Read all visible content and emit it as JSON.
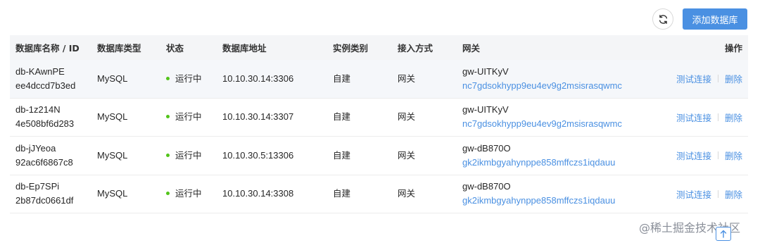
{
  "toolbar": {
    "refresh_icon": "refresh-icon",
    "add_label": "添加数据库"
  },
  "columns": {
    "name": "数据库名称 / ID",
    "type": "数据库类型",
    "status": "状态",
    "address": "数据库地址",
    "instance": "实例类别",
    "access": "接入方式",
    "gateway": "网关",
    "ops": "操作"
  },
  "rows": [
    {
      "name": "db-KAwnPE",
      "id": "ee4dccd7b3ed",
      "type": "MySQL",
      "status": "运行中",
      "address": "10.10.30.14:3306",
      "instance": "自建",
      "access": "网关",
      "gateway_name": "gw-UITKyV",
      "gateway_id": "nc7gdsokhypp9eu4ev9g2msisrasqwmc",
      "op_test": "测试连接",
      "op_delete": "删除"
    },
    {
      "name": "db-1z214N",
      "id": "4e508bf6d283",
      "type": "MySQL",
      "status": "运行中",
      "address": "10.10.30.14:3307",
      "instance": "自建",
      "access": "网关",
      "gateway_name": "gw-UITKyV",
      "gateway_id": "nc7gdsokhypp9eu4ev9g2msisrasqwmc",
      "op_test": "测试连接",
      "op_delete": "删除"
    },
    {
      "name": "db-jJYeoa",
      "id": "92ac6f6867c8",
      "type": "MySQL",
      "status": "运行中",
      "address": "10.10.30.5:13306",
      "instance": "自建",
      "access": "网关",
      "gateway_name": "gw-dB870O",
      "gateway_id": "gk2ikmbgyahynppe858mffczs1iqdauu",
      "op_test": "测试连接",
      "op_delete": "删除"
    },
    {
      "name": "db-Ep7SPi",
      "id": "2b87dc0661df",
      "type": "MySQL",
      "status": "运行中",
      "address": "10.10.30.14:3308",
      "instance": "自建",
      "access": "网关",
      "gateway_name": "gw-dB870O",
      "gateway_id": "gk2ikmbgyahynppe858mffczs1iqdauu",
      "op_test": "测试连接",
      "op_delete": "删除"
    }
  ],
  "colors": {
    "accent": "#4a90e2",
    "running": "#52c41a",
    "header_bg": "#f4f5f7"
  },
  "watermark": "@稀土掘金技术社区"
}
